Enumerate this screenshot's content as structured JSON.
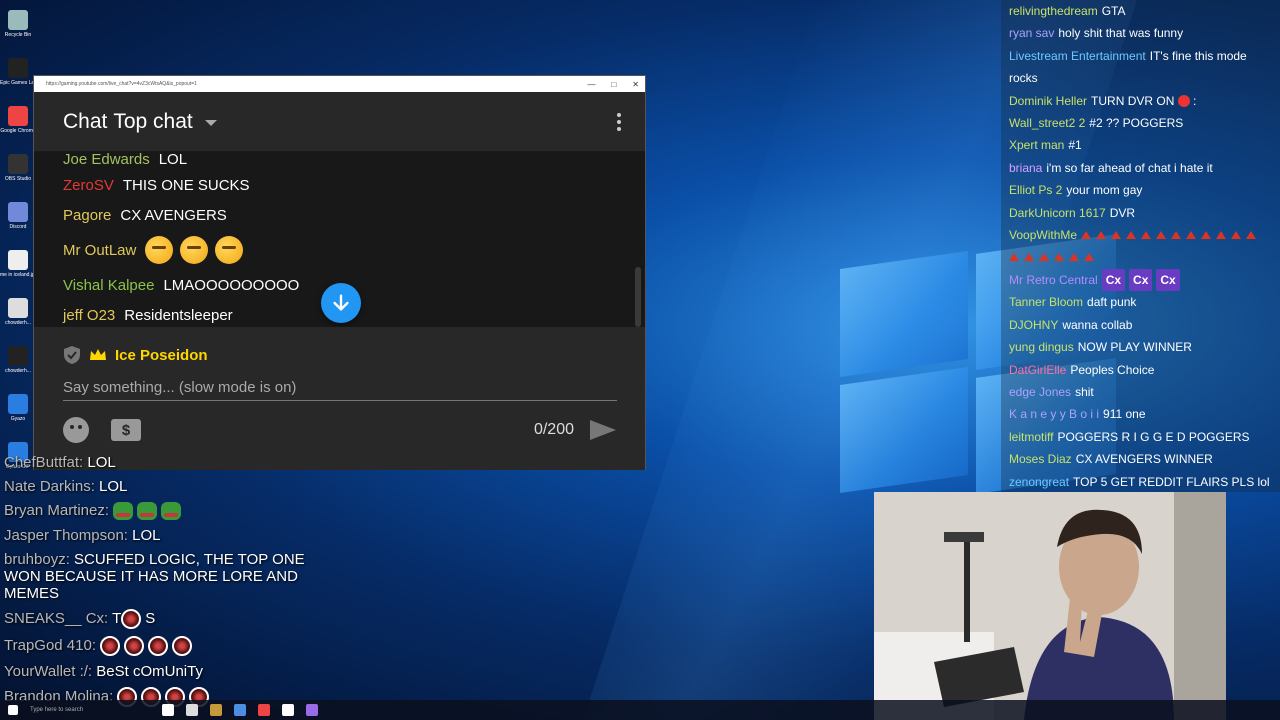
{
  "desktop": {
    "icons": [
      {
        "label": "Recycle Bin",
        "color": "#9bb"
      },
      {
        "label": "Epic Games Launcher",
        "color": "#222"
      },
      {
        "label": "Google Chrome",
        "color": "#e44"
      },
      {
        "label": "OBS Studio",
        "color": "#333"
      },
      {
        "label": "Discord",
        "color": "#7289da"
      },
      {
        "label": "me in iceland.jpg",
        "color": "#eee"
      },
      {
        "label": "chowderh...",
        "color": "#ddd"
      },
      {
        "label": "chowderh...",
        "color": "#222"
      },
      {
        "label": "Gyazo",
        "color": "#2a7de1"
      },
      {
        "label": "Gyazo GIF",
        "color": "#2a7de1"
      }
    ]
  },
  "popup": {
    "url": "https://gaming.youtube.com/live_chat?v=4vZ3cWtsAQ&is_popout=1",
    "header_title": "Chat",
    "header_mode": "Top chat",
    "messages": [
      {
        "author": "Joe Edwards",
        "author_color": "#a3c25e",
        "text": "LOL"
      },
      {
        "author": "ZeroSV",
        "author_color": "#e53935",
        "text": "THIS ONE SUCKS"
      },
      {
        "author": "Pagore",
        "author_color": "#e0c95a",
        "text": "CX AVENGERS"
      },
      {
        "author": "Mr OutLaw",
        "author_color": "#e0c95a",
        "text": "",
        "emojis": 3
      },
      {
        "author": "Vishal Kalpee",
        "author_color": "#8bc34a",
        "text": "LMAOOOOOOOOO"
      },
      {
        "author": "jeff O23",
        "author_color": "#e0c95a",
        "text": "Residentsleeper"
      }
    ],
    "username": "Ice Poseidon",
    "input_placeholder": "Say something... (slow mode is on)",
    "char_counter": "0/200"
  },
  "overlay_left": [
    {
      "author": "ChefButtfat:",
      "text": "LOL"
    },
    {
      "author": "Nate Darkins:",
      "text": "LOL"
    },
    {
      "author": "Bryan Martinez:",
      "text": "",
      "frogs": 3
    },
    {
      "author": "Jasper Thompson:",
      "text": "LOL"
    },
    {
      "author": "bruhboyz:",
      "text": "SCUFFED LOGIC, THE TOP ONE WON BECAUSE IT HAS MORE LORE AND MEMES"
    },
    {
      "author": "SNEAKS__ Cx:",
      "text": "T S",
      "dots": 1
    },
    {
      "author": "TrapGod 410:",
      "text": "",
      "dots": 4
    },
    {
      "author": "YourWallet :/:",
      "text": "BeSt cOmUniTy"
    },
    {
      "author": "Brandon Molina:",
      "text": "",
      "dots": 4
    }
  ],
  "overlay_right": [
    {
      "author": "relivingthedream",
      "color": "#c7e26a",
      "text": "GTA"
    },
    {
      "author": "ryan sav",
      "color": "#a9a2ff",
      "text": "holy shit that was funny"
    },
    {
      "author": "Livestream Entertainment",
      "color": "#6fc8ff",
      "text": "IT's fine this mode rocks"
    },
    {
      "author": "Dominik Heller",
      "color": "#c7e26a",
      "text": "TURN DVR ON",
      "stop": true,
      "suffix": ":"
    },
    {
      "author": "Wall_street2 2",
      "color": "#c7e26a",
      "text": "#2 ?? POGGERS"
    },
    {
      "author": "Xpert man",
      "color": "#c7e26a",
      "text": "#1"
    },
    {
      "author": "briana",
      "color": "#d8a0ff",
      "text": "i'm so far ahead of chat i hate it"
    },
    {
      "author": "Elliot Ps 2",
      "color": "#c7e26a",
      "text": "your mom gay"
    },
    {
      "author": "DarkUnicorn 1617",
      "color": "#c7e26a",
      "text": "DVR"
    },
    {
      "author": "VoopWithMe",
      "color": "#c7e26a",
      "text": "",
      "triangles": 18
    },
    {
      "author": "Mr Retro Central",
      "color": "#b58cff",
      "text": "",
      "cx": [
        "Cx",
        "Cx",
        "Cx"
      ]
    },
    {
      "author": "Tanner Bloom",
      "color": "#c7e26a",
      "text": "daft punk"
    },
    {
      "author": "DJOHNY",
      "color": "#c7e26a",
      "text": "wanna collab"
    },
    {
      "author": "yung dingus",
      "color": "#c7e26a",
      "text": "NOW PLAY WINNER"
    },
    {
      "author": "DatGirlElle",
      "color": "#ff6fa8",
      "text": "Peoples Choice"
    },
    {
      "author": "edge Jones",
      "color": "#a9a2ff",
      "text": "shit"
    },
    {
      "author": "K a n e y y B o i i",
      "color": "#a9a2ff",
      "text": "911 one"
    },
    {
      "author": "leitmotiff",
      "color": "#c7e26a",
      "text": "POGGERS R I G G E D POGGERS"
    },
    {
      "author": "Moses Diaz",
      "color": "#c7e26a",
      "text": "CX AVENGERS WINNER"
    },
    {
      "author": "zenongreat",
      "color": "#6fc8ff",
      "text": "TOP 5 GET REDDIT FLAIRS PLS lol"
    }
  ],
  "taskbar": {
    "search_placeholder": "Type here to search",
    "icon_colors": [
      "#fff",
      "#ddd",
      "#c49a3a",
      "#4a90e2",
      "#e44",
      "#fff",
      "#9a6be8"
    ]
  }
}
